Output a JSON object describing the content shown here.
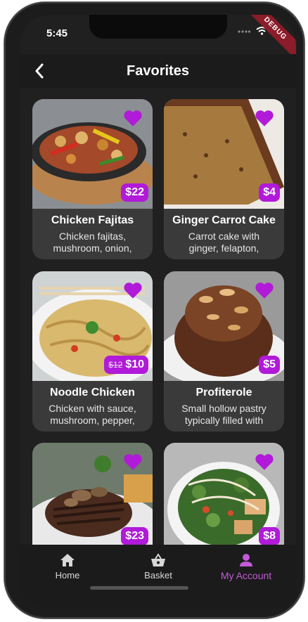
{
  "status": {
    "time": "5:45",
    "debug_label": "DEBUG"
  },
  "appbar": {
    "title": "Favorites",
    "back_icon": "chevron-left-icon"
  },
  "colors": {
    "accent": "#b01ad8",
    "heart": "#b01ad8",
    "card_bg": "#3a3a3a",
    "active_tab": "#c35ad8"
  },
  "items": [
    {
      "name": "Chicken Fajitas",
      "desc_line1": "Chicken fajitas,",
      "desc_line2": "mushroom, onion,",
      "price": "$22",
      "old_price": ""
    },
    {
      "name": "Ginger Carrot Cake",
      "desc_line1": "Carrot cake with",
      "desc_line2": "ginger, felapton,",
      "price": "$4",
      "old_price": ""
    },
    {
      "name": "Noodle Chicken",
      "desc_line1": "Chicken with sauce,",
      "desc_line2": "mushroom, pepper,",
      "price": "$10",
      "old_price": "$12"
    },
    {
      "name": "Profiterole",
      "desc_line1": "Small hollow pastry",
      "desc_line2": "typically filled with",
      "price": "$5",
      "old_price": ""
    },
    {
      "name": "",
      "desc_line1": "",
      "desc_line2": "",
      "price": "$23",
      "old_price": ""
    },
    {
      "name": "",
      "desc_line1": "",
      "desc_line2": "",
      "price": "$8",
      "old_price": ""
    }
  ],
  "bottom_nav": {
    "home": {
      "label": "Home",
      "icon": "home-icon"
    },
    "basket": {
      "label": "Basket",
      "icon": "basket-icon"
    },
    "account": {
      "label": "My Account",
      "icon": "person-icon",
      "active": true
    }
  }
}
